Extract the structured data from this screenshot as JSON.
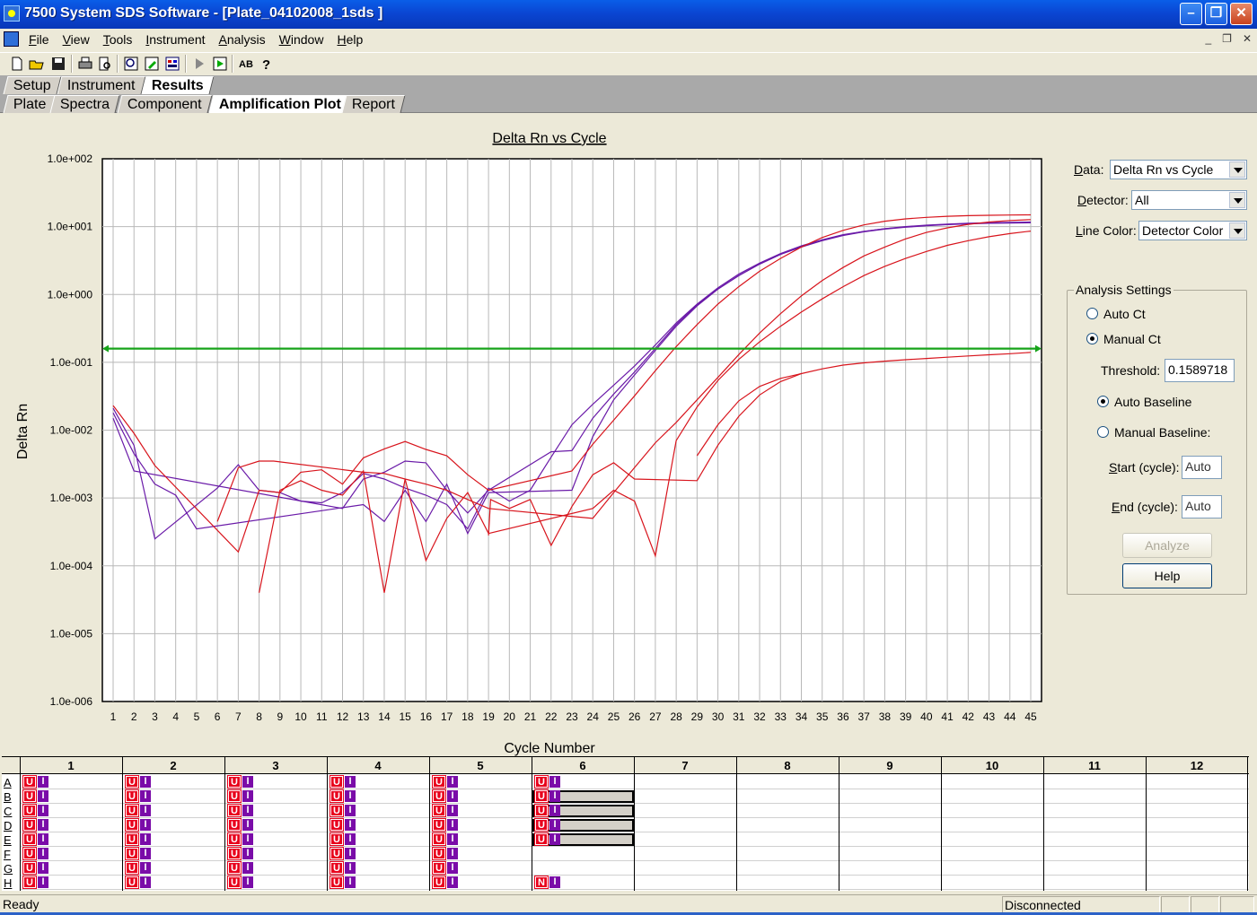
{
  "window": {
    "title": "7500 System SDS Software - [Plate_04102008_1sds ]"
  },
  "menu": [
    "File",
    "View",
    "Tools",
    "Instrument",
    "Analysis",
    "Window",
    "Help"
  ],
  "tabs_main": [
    {
      "label": "Setup",
      "active": false
    },
    {
      "label": "Instrument",
      "active": false
    },
    {
      "label": "Results",
      "active": true
    }
  ],
  "tabs_results": [
    {
      "label": "Plate",
      "active": false
    },
    {
      "label": "Spectra",
      "active": false
    },
    {
      "label": "Component",
      "active": false
    },
    {
      "label": "Amplification Plot",
      "active": true
    },
    {
      "label": "Report",
      "active": false
    }
  ],
  "panel": {
    "data_label": "Data:",
    "data_value": "Delta Rn vs Cycle",
    "detector_label": "Detector:",
    "detector_value": "All",
    "linecolor_label": "Line Color:",
    "linecolor_value": "Detector Color",
    "analysis_title": "Analysis Settings",
    "auto_ct": "Auto Ct",
    "manual_ct": "Manual Ct",
    "ct_mode": "manual",
    "threshold_label": "Threshold:",
    "threshold_value": "0.1589718",
    "auto_baseline": "Auto Baseline",
    "manual_baseline": "Manual Baseline:",
    "baseline_mode": "auto",
    "start_label": "Start (cycle):",
    "start_value": "Auto",
    "end_label": "End (cycle):",
    "end_value": "Auto",
    "analyze_button": "Analyze",
    "help_button": "Help"
  },
  "chart_data": {
    "type": "line",
    "title": "Delta Rn vs Cycle",
    "xlabel": "Cycle Number",
    "ylabel": "Delta Rn",
    "y_scale": "log",
    "ylim": [
      1e-06,
      100
    ],
    "y_ticks": [
      "1.0e+002",
      "1.0e+001",
      "1.0e+000",
      "1.0e-001",
      "1.0e-002",
      "1.0e-003",
      "1.0e-004",
      "1.0e-005",
      "1.0e-006"
    ],
    "x_ticks": [
      1,
      2,
      3,
      4,
      5,
      6,
      7,
      8,
      9,
      10,
      11,
      12,
      13,
      14,
      15,
      16,
      17,
      18,
      19,
      20,
      21,
      22,
      23,
      24,
      25,
      26,
      27,
      28,
      29,
      30,
      31,
      32,
      33,
      34,
      35,
      36,
      37,
      38,
      39,
      40,
      41,
      42,
      43,
      44,
      45
    ],
    "grid": true,
    "threshold": 0.1589718,
    "series": [
      {
        "color": "#6a1aa8",
        "points": [
          [
            1,
            0.021
          ],
          [
            2,
            0.006
          ],
          [
            3,
            0.00025
          ],
          [
            6,
            0.0014
          ],
          [
            7,
            0.0031
          ],
          [
            8,
            0.0013
          ],
          [
            9,
            0.0012
          ],
          [
            10,
            0.0009
          ],
          [
            11,
            0.00085
          ],
          [
            12,
            0.0012
          ],
          [
            13,
            0.0023
          ],
          [
            14,
            0.0019
          ],
          [
            15,
            0.0014
          ],
          [
            16,
            0.0011
          ],
          [
            17,
            0.0008
          ],
          [
            18,
            0.00035
          ],
          [
            19,
            0.0014
          ],
          [
            20,
            0.0009
          ],
          [
            21,
            0.0013
          ],
          [
            22,
            0.004
          ],
          [
            23,
            0.012
          ],
          [
            24,
            0.024
          ],
          [
            25,
            0.046
          ],
          [
            26,
            0.088
          ],
          [
            27,
            0.18
          ],
          [
            28,
            0.38
          ],
          [
            29,
            0.72
          ],
          [
            30,
            1.25
          ],
          [
            31,
            2.0
          ],
          [
            32,
            2.9
          ],
          [
            33,
            4.0
          ],
          [
            34,
            5.2
          ],
          [
            35,
            6.4
          ],
          [
            36,
            7.6
          ],
          [
            37,
            8.5
          ],
          [
            38,
            9.3
          ],
          [
            39,
            10.0
          ],
          [
            40,
            10.5
          ],
          [
            41,
            10.9
          ],
          [
            42,
            11.2
          ],
          [
            43,
            11.4
          ],
          [
            44,
            11.6
          ],
          [
            45,
            11.7
          ]
        ]
      },
      {
        "color": "#6a1aa8",
        "points": [
          [
            1,
            0.015
          ],
          [
            2,
            0.0025
          ],
          [
            12,
            0.0007
          ],
          [
            13,
            0.0019
          ],
          [
            14,
            0.0024
          ],
          [
            15,
            0.0035
          ],
          [
            16,
            0.0033
          ],
          [
            17,
            0.0013
          ],
          [
            18,
            0.0006
          ],
          [
            19,
            0.0013
          ],
          [
            22,
            0.0048
          ],
          [
            23,
            0.005
          ],
          [
            24,
            0.015
          ],
          [
            25,
            0.034
          ],
          [
            26,
            0.072
          ],
          [
            27,
            0.16
          ],
          [
            28,
            0.36
          ],
          [
            29,
            0.7
          ],
          [
            30,
            1.2
          ],
          [
            31,
            1.9
          ],
          [
            32,
            2.8
          ],
          [
            33,
            3.9
          ],
          [
            34,
            5.1
          ],
          [
            35,
            6.3
          ],
          [
            36,
            7.5
          ],
          [
            37,
            8.5
          ],
          [
            38,
            9.3
          ],
          [
            39,
            9.9
          ],
          [
            40,
            10.4
          ],
          [
            41,
            10.8
          ],
          [
            42,
            11.1
          ],
          [
            43,
            11.3
          ],
          [
            44,
            11.4
          ],
          [
            45,
            11.5
          ]
        ]
      },
      {
        "color": "#6a1aa8",
        "points": [
          [
            1,
            0.018
          ],
          [
            2,
            0.0045
          ],
          [
            3,
            0.0016
          ],
          [
            4,
            0.0011
          ],
          [
            5,
            0.00035
          ],
          [
            13,
            0.0008
          ],
          [
            14,
            0.00045
          ],
          [
            15,
            0.0013
          ],
          [
            16,
            0.00045
          ],
          [
            17,
            0.0016
          ],
          [
            18,
            0.0003
          ],
          [
            19,
            0.0012
          ],
          [
            23,
            0.0013
          ],
          [
            24,
            0.008
          ],
          [
            25,
            0.028
          ],
          [
            26,
            0.065
          ],
          [
            27,
            0.15
          ],
          [
            28,
            0.34
          ],
          [
            29,
            0.68
          ],
          [
            30,
            1.2
          ],
          [
            31,
            1.9
          ],
          [
            32,
            2.8
          ],
          [
            33,
            3.9
          ],
          [
            34,
            5.0
          ],
          [
            35,
            6.2
          ],
          [
            36,
            7.4
          ],
          [
            37,
            8.4
          ],
          [
            38,
            9.2
          ],
          [
            39,
            9.8
          ],
          [
            40,
            10.3
          ],
          [
            41,
            10.7
          ],
          [
            42,
            11.0
          ],
          [
            43,
            11.2
          ],
          [
            44,
            11.3
          ],
          [
            45,
            11.4
          ]
        ]
      },
      {
        "color": "#d8141c",
        "points": [
          [
            1,
            0.023
          ],
          [
            2,
            0.009
          ],
          [
            3,
            0.003
          ],
          [
            7,
            0.00016
          ],
          [
            8,
            0.0013
          ],
          [
            9,
            0.0012
          ],
          [
            10,
            0.0024
          ],
          [
            11,
            0.0026
          ],
          [
            12,
            0.0016
          ],
          [
            13,
            0.0039
          ],
          [
            14,
            0.0053
          ],
          [
            15,
            0.0068
          ],
          [
            16,
            0.0052
          ],
          [
            17,
            0.0042
          ],
          [
            18,
            0.0022
          ],
          [
            19,
            0.0013
          ],
          [
            23,
            0.0025
          ],
          [
            24,
            0.0062
          ],
          [
            25,
            0.014
          ],
          [
            26,
            0.032
          ],
          [
            27,
            0.075
          ],
          [
            28,
            0.17
          ],
          [
            29,
            0.36
          ],
          [
            30,
            0.72
          ],
          [
            31,
            1.3
          ],
          [
            32,
            2.2
          ],
          [
            33,
            3.4
          ],
          [
            34,
            5.0
          ],
          [
            35,
            6.9
          ],
          [
            36,
            8.8
          ],
          [
            37,
            10.6
          ],
          [
            38,
            12.0
          ],
          [
            39,
            13.0
          ],
          [
            40,
            13.7
          ],
          [
            41,
            14.2
          ],
          [
            42,
            14.5
          ],
          [
            43,
            14.7
          ],
          [
            44,
            14.8
          ],
          [
            45,
            14.9
          ]
        ]
      },
      {
        "color": "#d8141c",
        "points": [
          [
            6,
            0.00045
          ],
          [
            7,
            0.0028
          ],
          [
            8,
            0.0035
          ],
          [
            8.7,
            0.0035
          ],
          [
            13,
            0.0024
          ],
          [
            14,
            0.0023
          ],
          [
            15,
            0.0019
          ],
          [
            16,
            0.0016
          ],
          [
            17,
            0.0013
          ],
          [
            18,
            0.00095
          ],
          [
            19,
            0.0007
          ],
          [
            24,
            0.0005
          ],
          [
            25,
            0.0012
          ],
          [
            26,
            0.0028
          ],
          [
            27,
            0.0065
          ],
          [
            28,
            0.013
          ],
          [
            29,
            0.028
          ],
          [
            30,
            0.06
          ],
          [
            31,
            0.13
          ],
          [
            32,
            0.27
          ],
          [
            33,
            0.52
          ],
          [
            34,
            0.95
          ],
          [
            35,
            1.6
          ],
          [
            36,
            2.5
          ],
          [
            37,
            3.7
          ],
          [
            38,
            5.0
          ],
          [
            39,
            6.6
          ],
          [
            40,
            8.2
          ],
          [
            41,
            9.6
          ],
          [
            42,
            10.8
          ],
          [
            43,
            11.7
          ],
          [
            44,
            12.3
          ],
          [
            45,
            12.7
          ]
        ]
      },
      {
        "color": "#d8141c",
        "points": [
          [
            8,
            4e-05
          ],
          [
            9,
            0.0013
          ],
          [
            10,
            0.0018
          ],
          [
            11,
            0.0013
          ],
          [
            12,
            0.0011
          ],
          [
            13,
            0.0025
          ],
          [
            14,
            4e-05
          ],
          [
            15,
            0.0019
          ],
          [
            16,
            0.00012
          ],
          [
            17,
            0.0005
          ],
          [
            18,
            0.0012
          ],
          [
            19,
            0.0003
          ],
          [
            24,
            0.0007
          ],
          [
            25,
            0.0013
          ],
          [
            26,
            0.0009
          ],
          [
            27,
            0.00014
          ],
          [
            28,
            0.007
          ],
          [
            29,
            0.022
          ],
          [
            30,
            0.054
          ],
          [
            31,
            0.11
          ],
          [
            32,
            0.2
          ],
          [
            33,
            0.34
          ],
          [
            34,
            0.55
          ],
          [
            35,
            0.86
          ],
          [
            36,
            1.3
          ],
          [
            37,
            1.9
          ],
          [
            38,
            2.6
          ],
          [
            39,
            3.4
          ],
          [
            40,
            4.3
          ],
          [
            41,
            5.3
          ],
          [
            42,
            6.2
          ],
          [
            43,
            7.1
          ],
          [
            44,
            7.9
          ],
          [
            45,
            8.6
          ]
        ]
      },
      {
        "color": "#d8141c",
        "points": [
          [
            19,
            0.00028
          ],
          [
            19.1,
            0.00095
          ],
          [
            20,
            0.0007
          ],
          [
            21,
            0.00095
          ],
          [
            22,
            0.0002
          ],
          [
            23,
            0.00075
          ],
          [
            24,
            0.0022
          ],
          [
            25,
            0.0033
          ],
          [
            26,
            0.0019
          ],
          [
            29,
            0.0018
          ],
          [
            30,
            0.006
          ],
          [
            31,
            0.016
          ],
          [
            32,
            0.033
          ],
          [
            33,
            0.052
          ],
          [
            34,
            0.068
          ],
          [
            35,
            0.08
          ],
          [
            36,
            0.091
          ],
          [
            37,
            0.098
          ],
          [
            38,
            0.104
          ],
          [
            39,
            0.109
          ],
          [
            40,
            0.114
          ],
          [
            41,
            0.119
          ],
          [
            42,
            0.124
          ],
          [
            43,
            0.129
          ],
          [
            44,
            0.134
          ],
          [
            45,
            0.14
          ]
        ]
      },
      {
        "color": "#d8141c",
        "points": [
          [
            29,
            0.0042
          ],
          [
            30,
            0.012
          ],
          [
            31,
            0.027
          ],
          [
            32,
            0.044
          ],
          [
            33,
            0.058
          ],
          [
            34,
            0.068
          ]
        ]
      }
    ]
  },
  "plate": {
    "columns": [
      "1",
      "2",
      "3",
      "4",
      "5",
      "6",
      "7",
      "8",
      "9",
      "10",
      "11",
      "12"
    ],
    "rows": [
      "A",
      "B",
      "C",
      "D",
      "E",
      "F",
      "G",
      "H"
    ],
    "wells": {
      "u_label": "U",
      "n_label": "N",
      "i_label": "I"
    }
  },
  "status": {
    "left": "Ready",
    "connection": "Disconnected"
  }
}
